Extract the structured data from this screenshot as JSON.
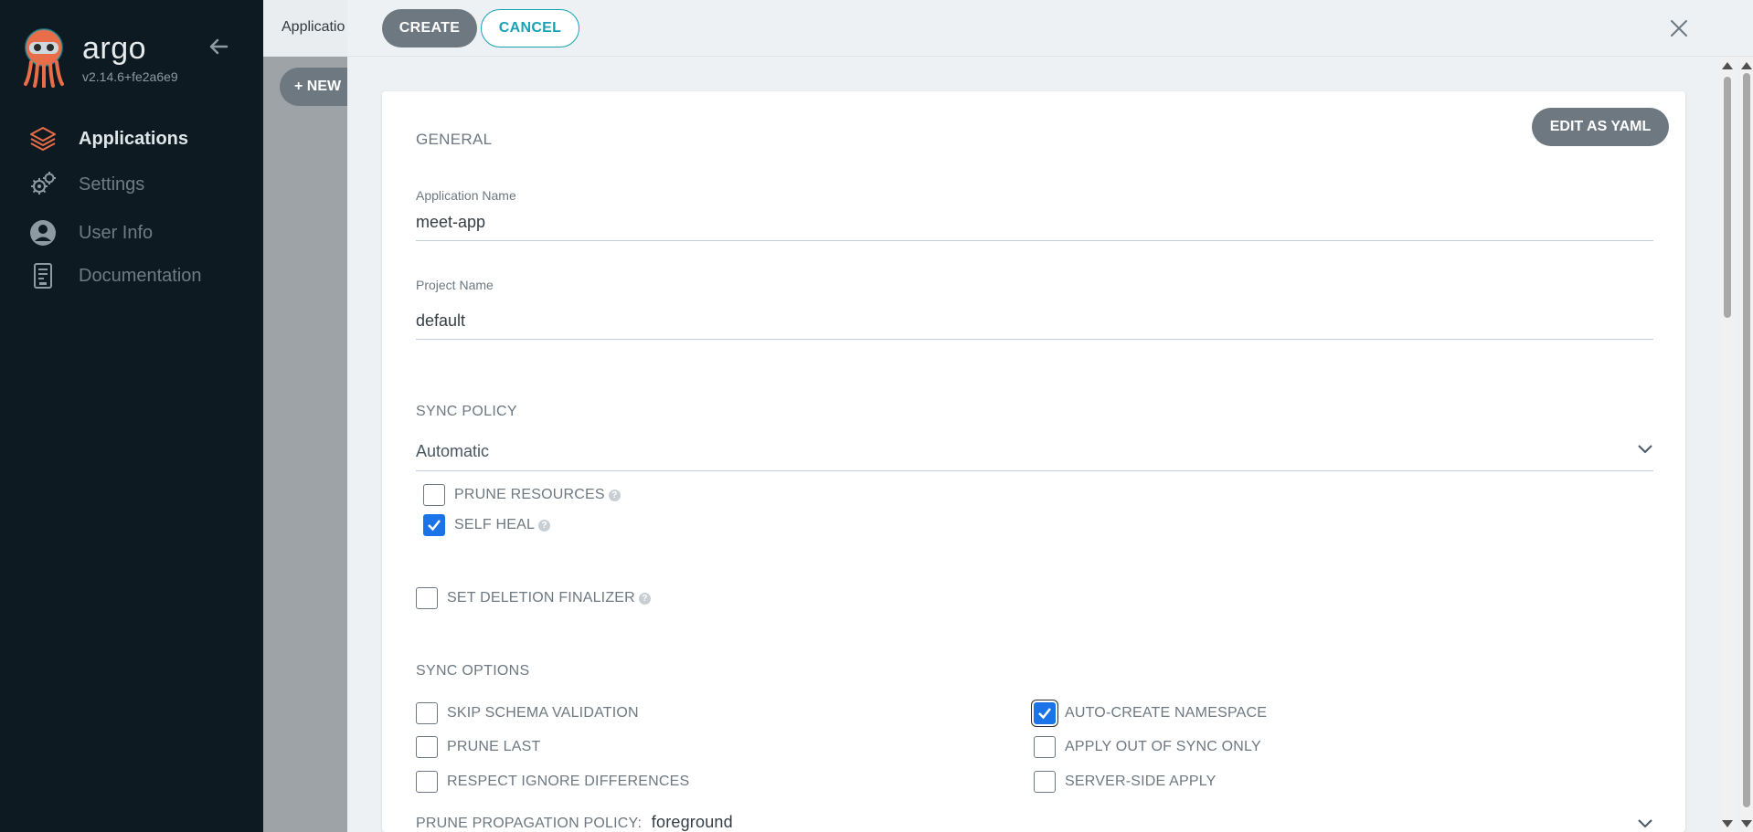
{
  "sidebar": {
    "brand": "argo",
    "version": "v2.14.6+fe2a6e9",
    "items": [
      {
        "label": "Applications",
        "icon": "stack-layers-icon",
        "active": true
      },
      {
        "label": "Settings",
        "icon": "gears-icon",
        "active": false
      },
      {
        "label": "User Info",
        "icon": "user-circle-icon",
        "active": false
      },
      {
        "label": "Documentation",
        "icon": "book-icon",
        "active": false
      }
    ]
  },
  "background": {
    "title": "Applicatio",
    "new_app_label": "+ NEW"
  },
  "panel": {
    "create_label": "CREATE",
    "cancel_label": "CANCEL",
    "edit_yaml_label": "EDIT AS YAML",
    "general": {
      "heading": "GENERAL",
      "app_name_label": "Application Name",
      "app_name_value": "meet-app",
      "project_name_label": "Project Name",
      "project_name_value": "default"
    },
    "sync_policy": {
      "heading": "SYNC POLICY",
      "value": "Automatic",
      "prune_resources": {
        "label": "PRUNE RESOURCES",
        "checked": false
      },
      "self_heal": {
        "label": "SELF HEAL",
        "checked": true
      },
      "set_deletion_finalizer": {
        "label": "SET DELETION FINALIZER",
        "checked": false
      }
    },
    "sync_options": {
      "heading": "SYNC OPTIONS",
      "options": [
        {
          "label": "SKIP SCHEMA VALIDATION",
          "checked": false
        },
        {
          "label": "PRUNE LAST",
          "checked": false
        },
        {
          "label": "RESPECT IGNORE DIFFERENCES",
          "checked": false
        },
        {
          "label": "AUTO-CREATE NAMESPACE",
          "checked": true
        },
        {
          "label": "APPLY OUT OF SYNC ONLY",
          "checked": false
        },
        {
          "label": "SERVER-SIDE APPLY",
          "checked": false
        }
      ]
    },
    "prune_propagation": {
      "label": "PRUNE PROPAGATION POLICY:",
      "value": "foreground"
    }
  },
  "colors": {
    "sidebar_bg": "#0d1a21",
    "accent_teal": "#18a2b6",
    "button_gray": "#6d7880",
    "checkbox_blue": "#1a73e8",
    "logo_orange": "#e96d48"
  }
}
